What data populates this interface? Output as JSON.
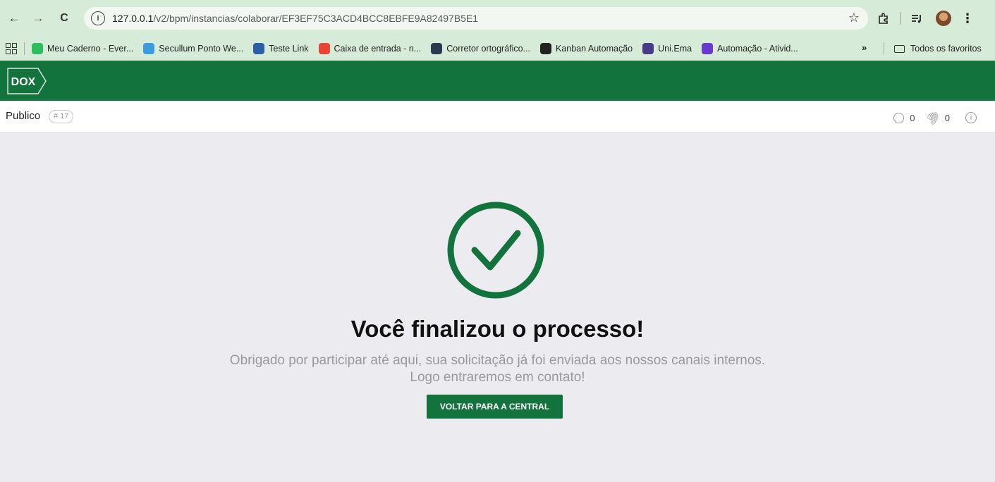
{
  "browser": {
    "url_host": "127.0.0.1",
    "url_path": "/v2/bpm/instancias/colaborar/EF3EF75C3ACD4BCC8EBFE9A82497B5E1",
    "bookmarks": [
      {
        "label": "Meu Caderno - Ever...",
        "icon": "evernote-icon",
        "color": "#2dbe60"
      },
      {
        "label": "Secullum Ponto We...",
        "icon": "secullum-icon",
        "color": "#3b9be0"
      },
      {
        "label": "Teste Link",
        "icon": "testlink-icon",
        "color": "#2d5fa8"
      },
      {
        "label": "Caixa de entrada - n...",
        "icon": "gmail-icon",
        "color": "#ea4335"
      },
      {
        "label": "Corretor ortográfico...",
        "icon": "languagetool-icon",
        "color": "#2a3b4f"
      },
      {
        "label": "Kanban Automação",
        "icon": "kanban-icon",
        "color": "#222222"
      },
      {
        "label": "Uni.Ema",
        "icon": "graduation-cap-icon",
        "color": "#4a3a8a"
      },
      {
        "label": "Automação - Ativid...",
        "icon": "trello-icon",
        "color": "#6a3ad0"
      }
    ],
    "bookmarks_more": "»",
    "favorites_folder": "Todos os favoritos"
  },
  "app": {
    "logo_text": "DOX",
    "header_color": "#13733d"
  },
  "subheader": {
    "process_name": "Publico",
    "process_id": "# 17",
    "comments_count": "0",
    "attachments_count": "0"
  },
  "main": {
    "title": "Você finalizou o processo!",
    "message_line1": "Obrigado por participar até aqui, sua solicitação já foi enviada aos nossos canais internos.",
    "message_line2": "Logo entraremos em contato!",
    "cta_label": "VOLTAR PARA A CENTRAL",
    "accent_color": "#13733d"
  }
}
